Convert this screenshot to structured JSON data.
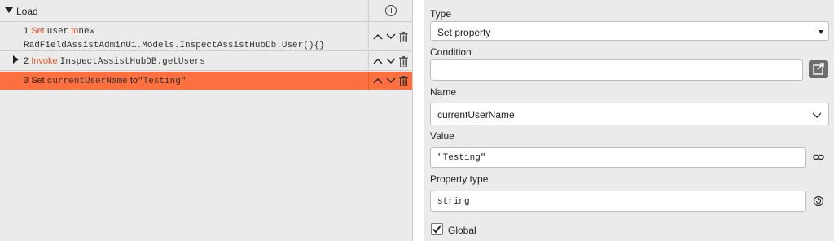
{
  "left_panel": {
    "section_title": "Load",
    "steps": [
      {
        "number": "1",
        "action": "Set",
        "target": "user",
        "to": "to",
        "value_line1": "new",
        "value_line2": "RadFieldAssistAdminUi.Models.InspectAssistHubDb.User(){}"
      },
      {
        "number": "2",
        "action": "Invoke",
        "target": "InspectAssistHubDB.getUsers"
      },
      {
        "number": "3",
        "action": "Set",
        "target": "currentUserName",
        "to": "to",
        "value": "\"Testing\""
      }
    ]
  },
  "right_panel": {
    "type_label": "Type",
    "type_value": "Set property",
    "condition_label": "Condition",
    "condition_value": "",
    "name_label": "Name",
    "name_value": "currentUserName",
    "value_label": "Value",
    "value_value": "\"Testing\"",
    "property_type_label": "Property type",
    "property_type_value": "string",
    "global_label": "Global",
    "global_checked": true
  },
  "colors": {
    "selected_row": "#ff7040",
    "keyword": "#e8552a",
    "panel_bg": "#ebebeb"
  },
  "icons": [
    "add-circle-icon",
    "expand-triangle-icon",
    "move-up-icon",
    "move-down-icon",
    "trash-icon",
    "external-link-icon",
    "link-icon",
    "refresh-icon",
    "checkmark-icon",
    "dropdown-caret-icon",
    "chevron-down-icon"
  ]
}
